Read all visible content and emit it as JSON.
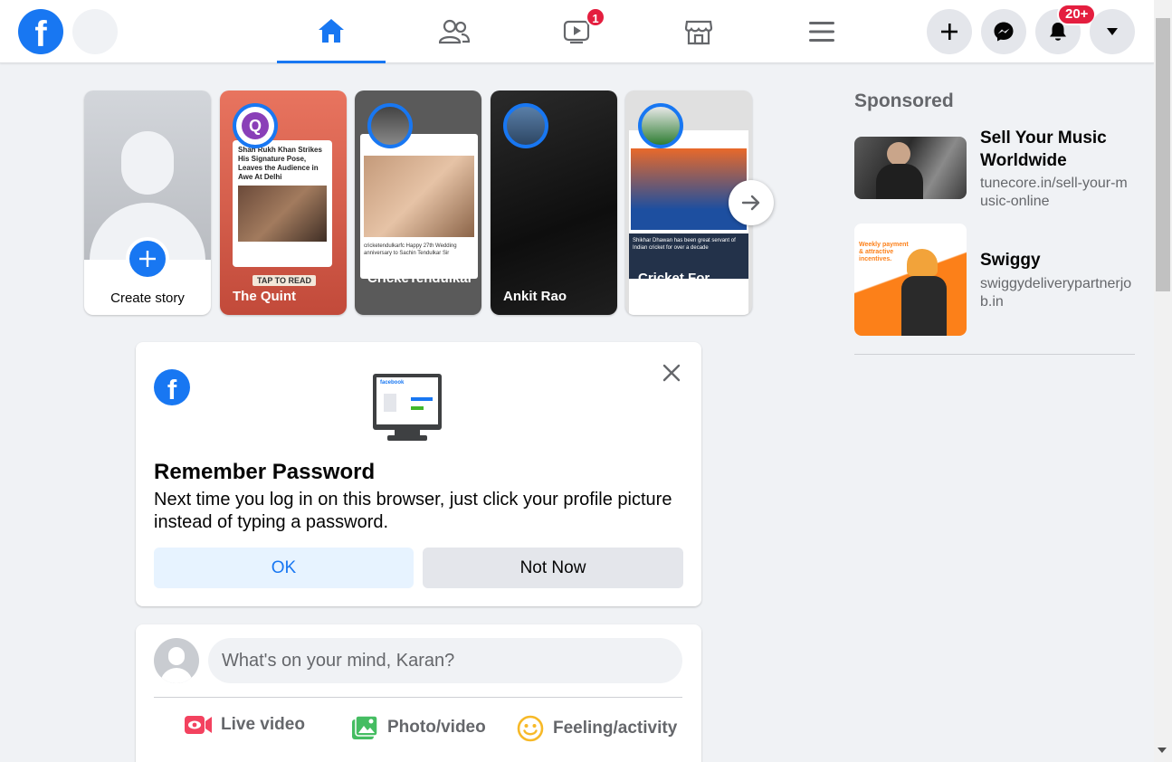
{
  "nav": {
    "logo": "f",
    "watch_badge": "1",
    "notifications_badge": "20+",
    "tabs": [
      "home",
      "friends",
      "watch",
      "marketplace",
      "menu"
    ]
  },
  "stories": [
    {
      "name": "Create story",
      "type": "create"
    },
    {
      "name": "The Quint",
      "preview_headline": "Shah Rukh Khan Strikes His Signature Pose, Leaves the Audience in Awe At Delhi",
      "cta": "TAP TO READ"
    },
    {
      "name": "CrickeTendulkar",
      "preview_caption": "cricketendulkarfc Happy 27th Wedding anniversary to Sachin Tendulkar Sir"
    },
    {
      "name": "Ankit Rao"
    },
    {
      "name": "Cricket For India",
      "preview_caption": "Shikhar Dhawan has been great servant of Indian cricket for over a decade"
    }
  ],
  "remember_password": {
    "title": "Remember Password",
    "text": "Next time you log in on this browser, just click your profile picture instead of typing a password.",
    "ok_label": "OK",
    "not_now_label": "Not Now",
    "monitor_text": "facebook"
  },
  "composer": {
    "placeholder": "What's on your mind, Karan?",
    "live_label": "Live video",
    "photo_label": "Photo/video",
    "feeling_label": "Feeling/activity"
  },
  "sponsored": {
    "heading": "Sponsored",
    "ads": [
      {
        "title": "Sell Your Music Worldwide",
        "url": "tunecore.in/sell-your-music-online"
      },
      {
        "title": "Swiggy",
        "url": "swiggydeliverypartnerjob.in",
        "image_text": "Weekly payment & attractive incentives."
      }
    ]
  },
  "colors": {
    "brand": "#1877f2",
    "badge": "#e41e3f",
    "background": "#f0f2f5"
  }
}
